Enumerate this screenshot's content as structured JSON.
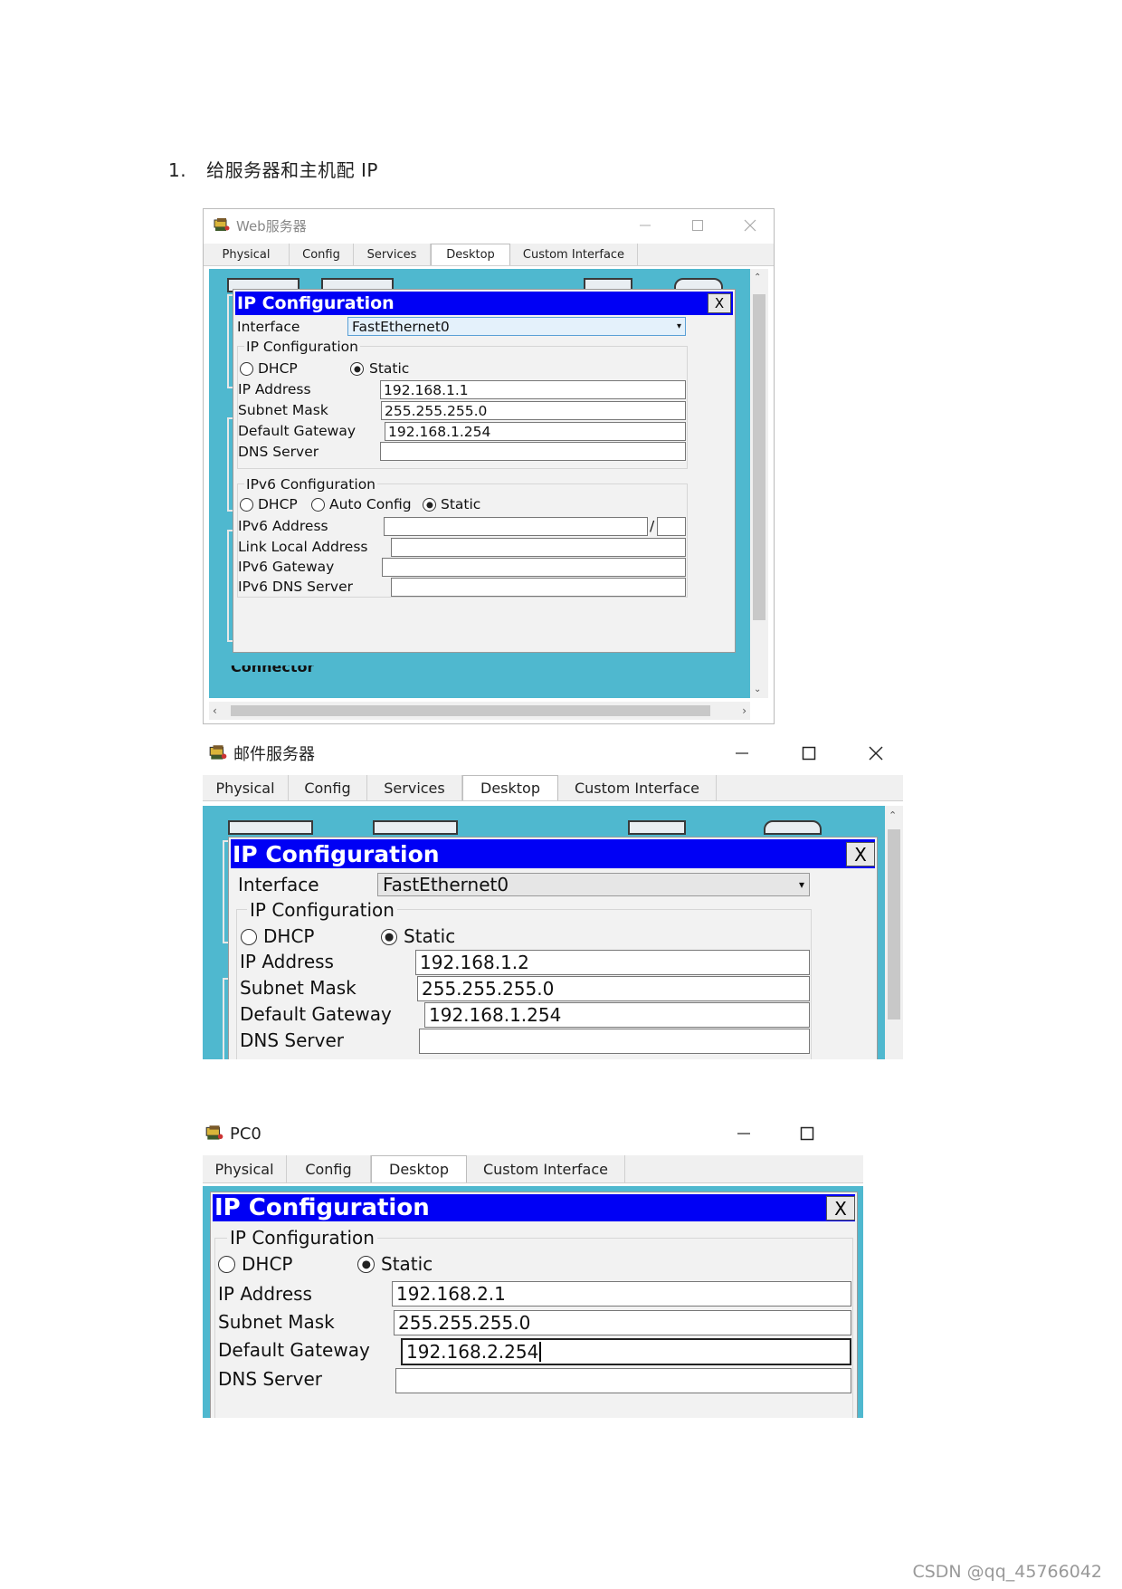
{
  "heading": {
    "number": "1.",
    "text": "给服务器和主机配 IP"
  },
  "footer": "CSDN @qq_45766042",
  "tab_labels": {
    "physical": "Physical",
    "config": "Config",
    "services": "Services",
    "desktop": "Desktop",
    "custom": "Custom Interface"
  },
  "dialog": {
    "title": "IP Configuration",
    "close": "X",
    "interface_label": "Interface",
    "ipv4_group": "IP Configuration",
    "dhcp": "DHCP",
    "static": "Static",
    "ip_address": "IP Address",
    "subnet_mask": "Subnet Mask",
    "default_gateway": "Default Gateway",
    "dns_server": "DNS Server",
    "ipv6_group": "IPv6 Configuration",
    "auto_config": "Auto Config",
    "ipv6_address": "IPv6 Address",
    "link_local": "Link Local Address",
    "ipv6_gateway": "IPv6 Gateway",
    "ipv6_dns": "IPv6 DNS Server",
    "slash": "/"
  },
  "window1": {
    "title": "Web服务器",
    "interface": "FastEthernet0",
    "ipv4_mode": "Static",
    "ipv6_mode": "Static",
    "ip": "192.168.1.1",
    "mask": "255.255.255.0",
    "gateway": "192.168.1.254",
    "dns": "",
    "bottom_text": "Connector"
  },
  "window2": {
    "title": "邮件服务器",
    "interface": "FastEthernet0",
    "ipv4_mode": "Static",
    "ip": "192.168.1.2",
    "mask": "255.255.255.0",
    "gateway": "192.168.1.254",
    "dns": ""
  },
  "window3": {
    "title": "PC0",
    "ipv4_mode": "Static",
    "ip": "192.168.2.1",
    "mask": "255.255.255.0",
    "gateway": "192.168.2.254",
    "dns": ""
  },
  "icons": {
    "app": "packet-tracer-app-icon",
    "minimize": "minimize-icon",
    "maximize": "maximize-icon",
    "close": "close-icon",
    "dropdown": "chevron-down-icon"
  },
  "colors": {
    "dialog_title": "#0000f5",
    "desktop_bg": "#4fb8cf"
  }
}
